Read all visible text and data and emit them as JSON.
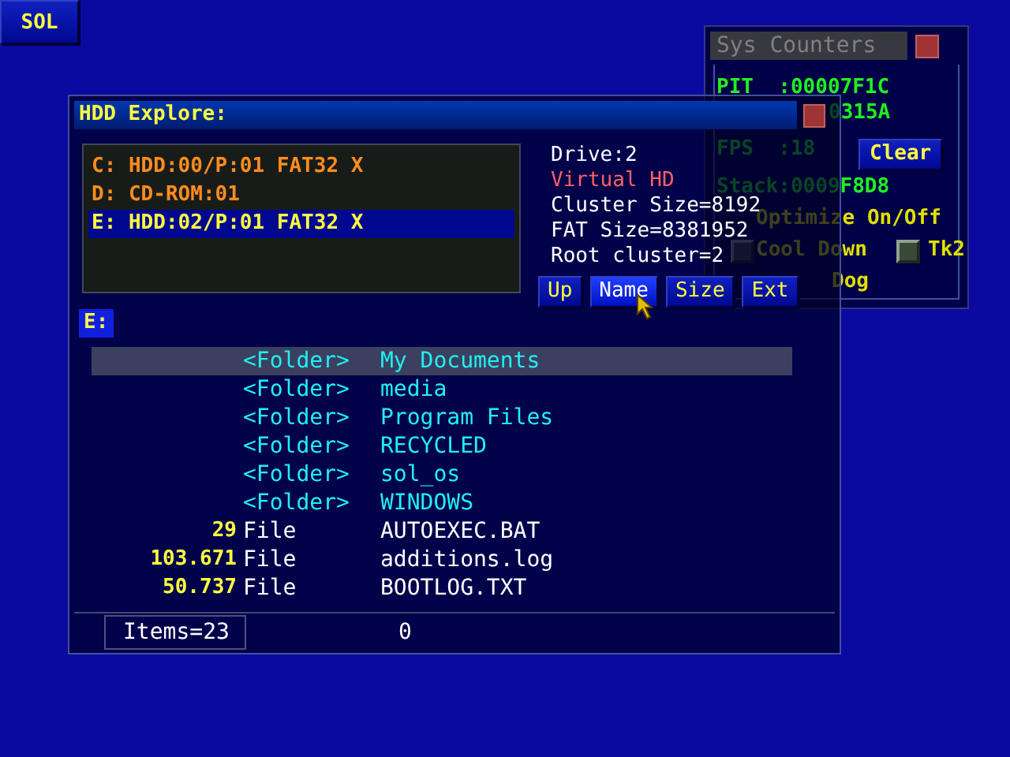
{
  "desktop_button": "SOL",
  "sys_counters": {
    "title": "Sys Counters",
    "pit": "PIT  :00007F1C",
    "pit_tail": "0315A",
    "fps": "FPS  :18",
    "clear_button": "Clear",
    "stack": "Stack:0009F8D8",
    "options": [
      {
        "label": "Optimize On/Off"
      },
      {
        "label": "Cool Down",
        "checked": false
      },
      {
        "label": "Tk2",
        "checked": false
      }
    ],
    "partial_option": "Dog"
  },
  "hdd_explorer": {
    "title": "HDD Explore:",
    "drives": [
      {
        "label": "C: HDD:00/P:01 FAT32 X",
        "selected": false
      },
      {
        "label": "D: CD-ROM:01",
        "selected": false
      },
      {
        "label": "E: HDD:02/P:01 FAT32 X",
        "selected": true
      }
    ],
    "info": {
      "drive": "Drive:2",
      "type": "Virtual HD",
      "lines": [
        "Cluster Size=8192",
        "FAT Size=8381952",
        "Root cluster=2"
      ]
    },
    "buttons": [
      {
        "label": "Up",
        "selected": false
      },
      {
        "label": "Name",
        "selected": true
      },
      {
        "label": "Size",
        "selected": false
      },
      {
        "label": "Ext",
        "selected": false
      }
    ],
    "path": "E:",
    "files": [
      {
        "kind": "folder",
        "type": "<Folder>",
        "name": "My Documents",
        "selected": true
      },
      {
        "kind": "folder",
        "type": "<Folder>",
        "name": "media",
        "selected": false
      },
      {
        "kind": "folder",
        "type": "<Folder>",
        "name": "Program Files",
        "selected": false
      },
      {
        "kind": "folder",
        "type": "<Folder>",
        "name": "RECYCLED",
        "selected": false
      },
      {
        "kind": "folder",
        "type": "<Folder>",
        "name": "sol_os",
        "selected": false
      },
      {
        "kind": "folder",
        "type": "<Folder>",
        "name": "WINDOWS",
        "selected": false
      },
      {
        "kind": "file",
        "size": "29",
        "type": "File",
        "name": "AUTOEXEC.BAT",
        "selected": false
      },
      {
        "kind": "file",
        "size": "103.671",
        "type": "File",
        "name": "additions.log",
        "selected": false
      },
      {
        "kind": "file",
        "size": "50.737",
        "type": "File",
        "name": "BOOTLOG.TXT",
        "selected": false
      }
    ],
    "status": {
      "items": "Items=23",
      "value": "0"
    }
  }
}
